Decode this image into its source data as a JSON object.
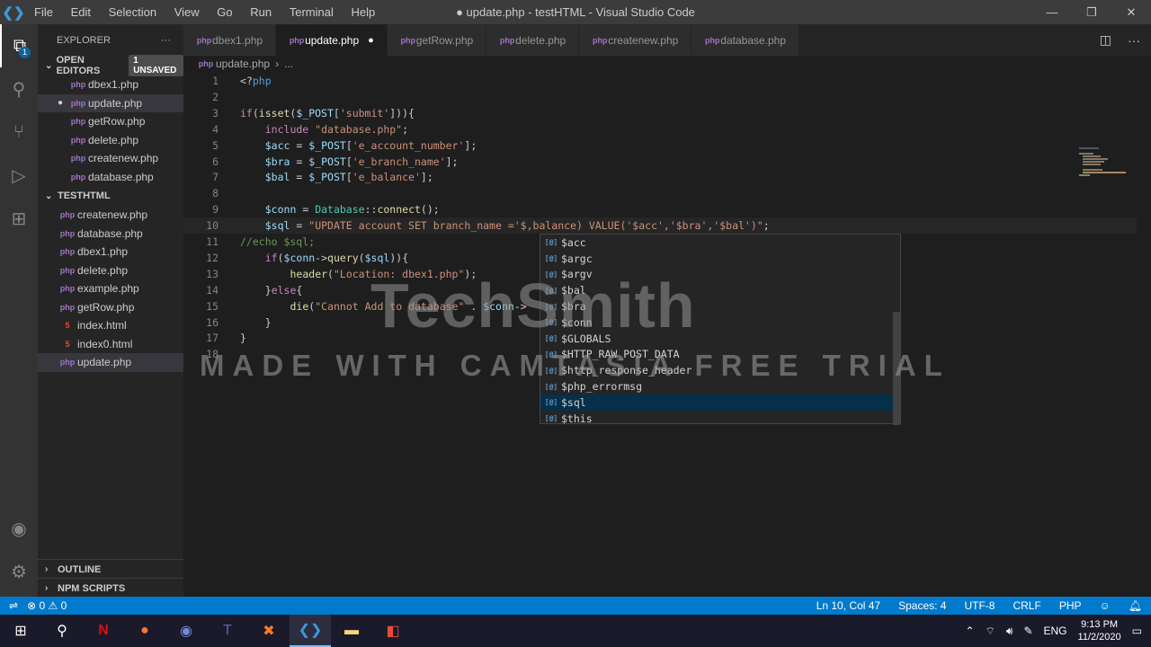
{
  "titlebar": {
    "menu": [
      "File",
      "Edit",
      "Selection",
      "View",
      "Go",
      "Run",
      "Terminal",
      "Help"
    ],
    "title": "● update.php - testHTML - Visual Studio Code"
  },
  "activity": {
    "explorer_badge": "1"
  },
  "sidebar": {
    "header": "EXPLORER",
    "open_editors_label": "OPEN EDITORS",
    "unsaved_badge": "1 UNSAVED",
    "open_editors": [
      {
        "name": "dbex1.php",
        "type": "php"
      },
      {
        "name": "update.php",
        "type": "php",
        "modified": true
      },
      {
        "name": "getRow.php",
        "type": "php"
      },
      {
        "name": "delete.php",
        "type": "php"
      },
      {
        "name": "createnew.php",
        "type": "php"
      },
      {
        "name": "database.php",
        "type": "php"
      }
    ],
    "folder_label": "TESTHTML",
    "files": [
      {
        "name": "createnew.php",
        "type": "php"
      },
      {
        "name": "database.php",
        "type": "php"
      },
      {
        "name": "dbex1.php",
        "type": "php"
      },
      {
        "name": "delete.php",
        "type": "php"
      },
      {
        "name": "example.php",
        "type": "php"
      },
      {
        "name": "getRow.php",
        "type": "php"
      },
      {
        "name": "index.html",
        "type": "html"
      },
      {
        "name": "index0.html",
        "type": "html"
      },
      {
        "name": "update.php",
        "type": "php",
        "selected": true
      }
    ],
    "outline_label": "OUTLINE",
    "npm_label": "NPM SCRIPTS"
  },
  "tabs": [
    {
      "name": "dbex1.php"
    },
    {
      "name": "update.php",
      "active": true,
      "modified": true
    },
    {
      "name": "getRow.php"
    },
    {
      "name": "delete.php"
    },
    {
      "name": "createnew.php"
    },
    {
      "name": "database.php"
    }
  ],
  "breadcrumb": {
    "file": "update.php",
    "rest": "..."
  },
  "editor": {
    "lines": [
      "<?php",
      "",
      "if(isset($_POST['submit'])){",
      "    include \"database.php\";",
      "    $acc = $_POST['e_account_number'];",
      "    $bra = $_POST['e_branch_name'];",
      "    $bal = $_POST['e_balance'];",
      "",
      "    $conn = Database::connect();",
      "    $sql = \"UPDATE account SET branch_name ='$,balance) VALUE('$acc','$bra','$bal')\";",
      "//echo $sql;",
      "    if($conn->query($sql)){",
      "        header(\"Location: dbex1.php\");",
      "    }else{",
      "        die(\"Cannot Add to database\" . $conn->",
      "    }",
      "}",
      ""
    ],
    "current_line": 10
  },
  "suggestions": {
    "items": [
      "$acc",
      "$argc",
      "$argv",
      "$bal",
      "$bra",
      "$conn",
      "$GLOBALS",
      "$HTTP_RAW_POST_DATA",
      "$http_response_header",
      "$php_errormsg",
      "$sql",
      "$this"
    ],
    "selected": "$sql"
  },
  "watermark": {
    "brand": "TechSmith",
    "trial": "MADE WITH CAMTASIA FREE TRIAL"
  },
  "statusbar": {
    "errors": "0",
    "warnings": "0",
    "position": "Ln 10, Col 47",
    "spaces": "Spaces: 4",
    "encoding": "UTF-8",
    "eol": "CRLF",
    "language": "PHP"
  },
  "taskbar": {
    "language": "ENG",
    "time": "9:13 PM",
    "date": "11/2/2020"
  }
}
